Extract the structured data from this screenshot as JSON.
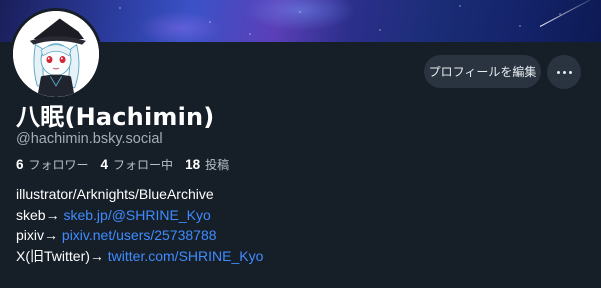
{
  "profile": {
    "display_name": "八眠(Hachimin)",
    "handle": "@hachimin.bsky.social",
    "edit_button_label": "プロフィールを編集",
    "more_button_icon": "ellipsis-icon"
  },
  "stats": {
    "followers_count": "6",
    "followers_label": "フォロワー",
    "following_count": "4",
    "following_label": "フォロー中",
    "posts_count": "18",
    "posts_label": "投稿"
  },
  "bio": {
    "line1": "illustrator/Arknights/BlueArchive",
    "line2_prefix": "skeb→ ",
    "line2_link": "skeb.jp/@SHRINE_Kyo",
    "line3_prefix": "pixiv→ ",
    "line3_link": "pixiv.net/users/25738788",
    "line4_prefix": "X(旧Twitter)→ ",
    "line4_link": "twitter.com/SHRINE_Kyo"
  },
  "colors": {
    "background": "#161e27",
    "link": "#3f8cff",
    "button_bg": "#2a3440"
  }
}
